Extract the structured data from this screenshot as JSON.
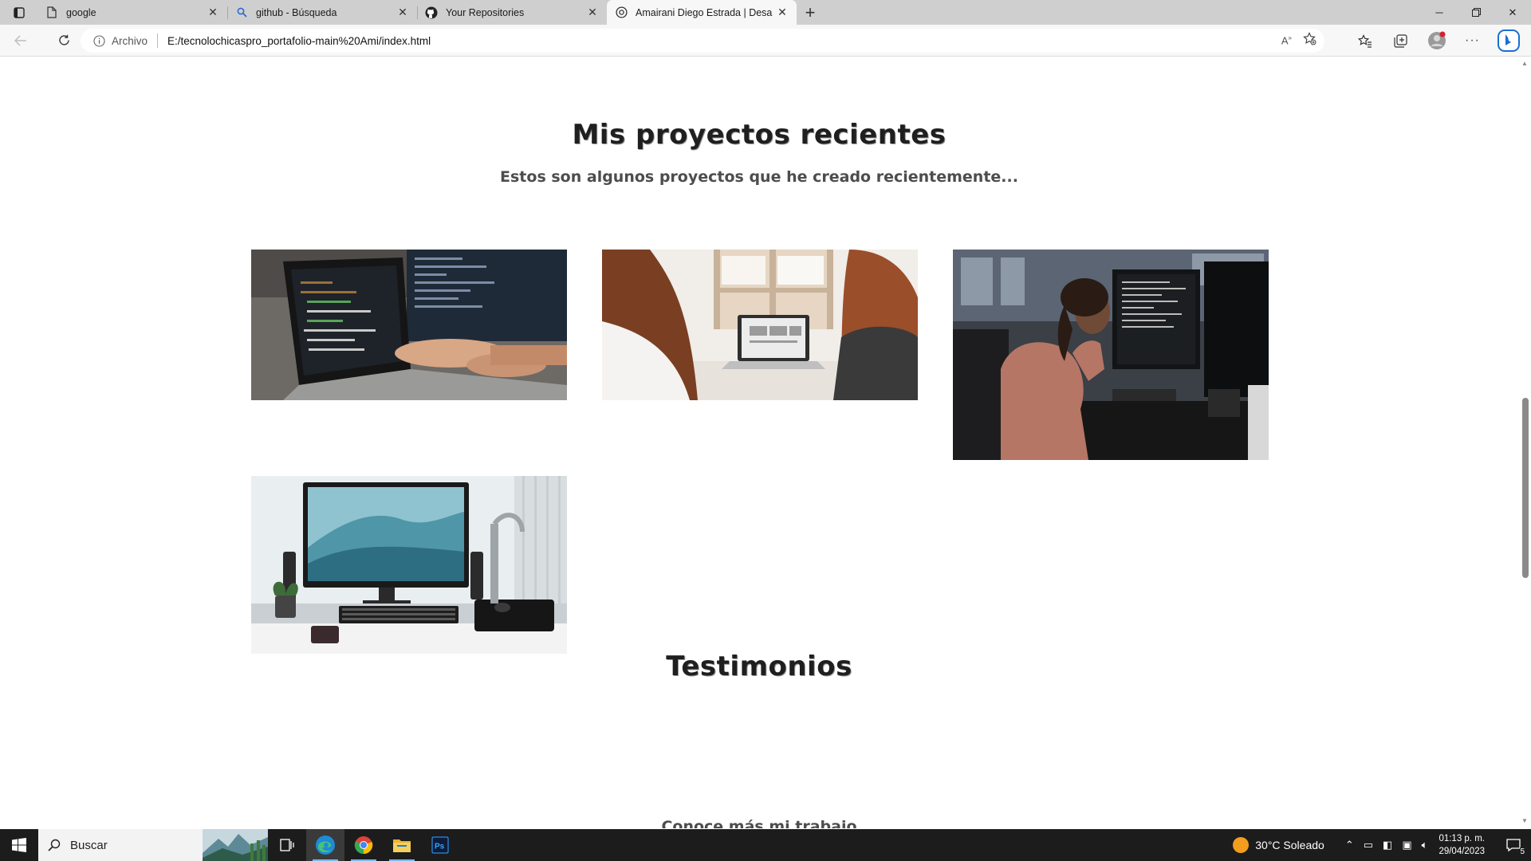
{
  "browser": {
    "tabs": [
      {
        "title": "google",
        "icon": "page-icon"
      },
      {
        "title": "github - Búsqueda",
        "icon": "search-icon"
      },
      {
        "title": "Your Repositories",
        "icon": "github-icon"
      },
      {
        "title": "Amairani Diego Estrada | Desarro",
        "icon": "globe-icon",
        "active": true
      }
    ],
    "address": {
      "scheme_label": "Archivo",
      "url": "E:/tecnolochicaspro_portafolio-main%20Ami/index.html"
    }
  },
  "page": {
    "projects_section": {
      "title": "Mis proyectos recientes",
      "subtitle": "Estos son algunos proyectos que he creado recientemente...",
      "images": [
        {
          "alt": "laptop-with-code"
        },
        {
          "alt": "two-people-at-laptop"
        },
        {
          "alt": "woman-at-monitors"
        },
        {
          "alt": "desktop-computer-setup"
        }
      ]
    },
    "testimonials_section": {
      "title": "Testimonios",
      "subtitle": "Conoce más mi trabajo"
    }
  },
  "taskbar": {
    "search_placeholder": "Buscar",
    "weather": "30°C  Soleado",
    "time": "01:13 p. m.",
    "date": "29/04/2023",
    "notification_count": "5"
  },
  "colors": {
    "title": "#1f1f1f",
    "subtitle": "#4d4d4d",
    "taskbar": "#1c1c1c",
    "tabstrip": "#cfcfcf"
  }
}
